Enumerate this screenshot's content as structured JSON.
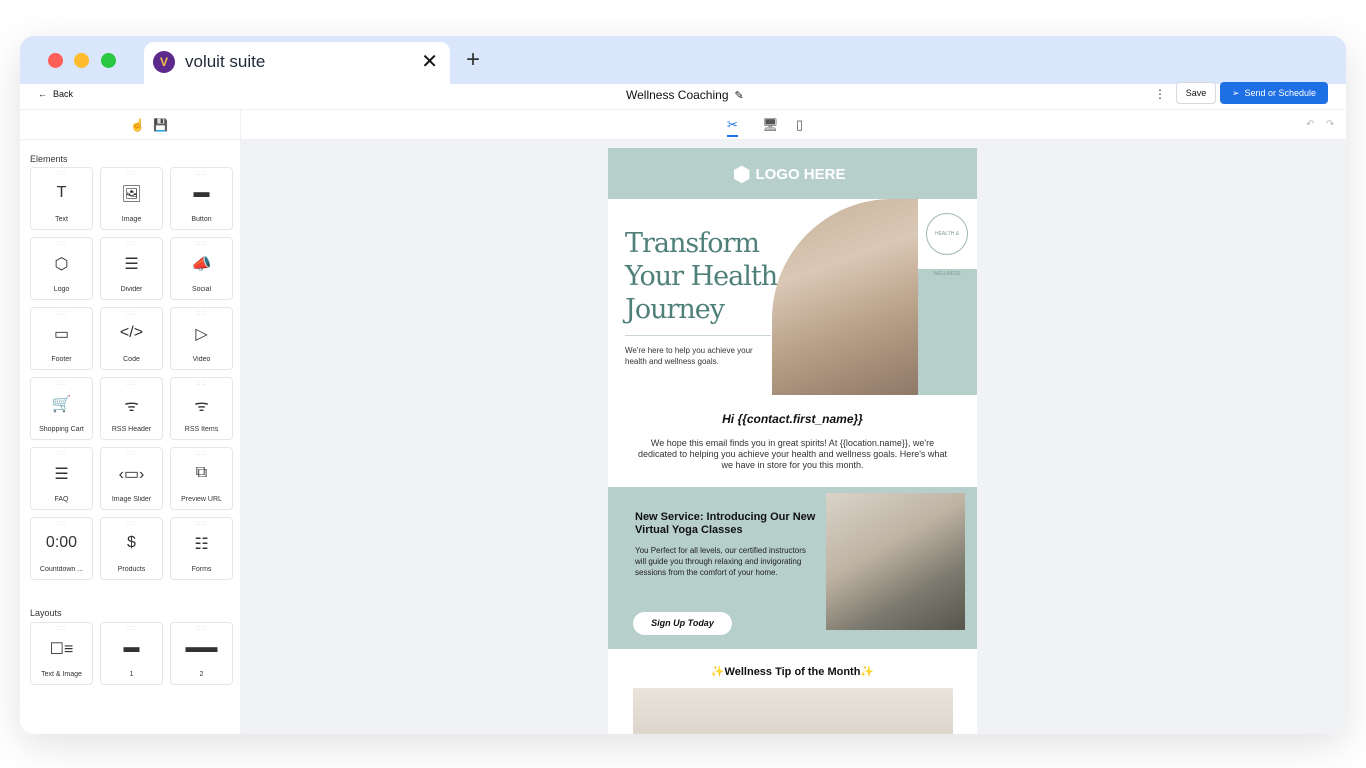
{
  "browser": {
    "tab_title": "voluit suite",
    "tab_close": "✕",
    "new_tab": "+"
  },
  "topbar": {
    "back_label": "Back",
    "document_title": "Wellness Coaching",
    "save_label": "Save",
    "send_label": "Send or Schedule"
  },
  "sidebar": {
    "elements_title": "Elements",
    "elements": [
      {
        "label": "Text",
        "icon": "T"
      },
      {
        "label": "Image",
        "icon": "🖼"
      },
      {
        "label": "Button",
        "icon": "▬"
      },
      {
        "label": "Logo",
        "icon": "⬡"
      },
      {
        "label": "Divider",
        "icon": "☰"
      },
      {
        "label": "Social",
        "icon": "📣"
      },
      {
        "label": "Footer",
        "icon": "▭"
      },
      {
        "label": "Code",
        "icon": "</>"
      },
      {
        "label": "Video",
        "icon": "▷"
      },
      {
        "label": "Shopping Cart",
        "icon": "🛒"
      },
      {
        "label": "RSS Header",
        "icon": "ᯤ"
      },
      {
        "label": "RSS Items",
        "icon": "ᯤ"
      },
      {
        "label": "FAQ",
        "icon": "☰"
      },
      {
        "label": "Image Slider",
        "icon": "‹▭›"
      },
      {
        "label": "Preview URL",
        "icon": "⧉"
      },
      {
        "label": "Countdown ...",
        "icon": "0:00"
      },
      {
        "label": "Products",
        "icon": "$"
      },
      {
        "label": "Forms",
        "icon": "☷"
      }
    ],
    "layouts_title": "Layouts",
    "layouts": [
      {
        "label": "Text & Image",
        "icon": "☐≡"
      },
      {
        "label": "1",
        "icon": "▬"
      },
      {
        "label": "2",
        "icon": "▬▬"
      }
    ]
  },
  "email": {
    "logo_text": "LOGO HERE",
    "hero_title": "Transform Your Health Journey",
    "hero_subtitle": "We're here to help you achieve your health and wellness goals.",
    "badge_text": "HEALTH & WELLNESS",
    "greeting": "Hi {{contact.first_name}}",
    "intro": "We hope this email finds you in great spirits! At {{location.name}}, we're dedicated to helping you achieve your health and wellness goals. Here's what we have in store for you this month.",
    "promo_title": "New Service: Introducing Our New Virtual Yoga Classes",
    "promo_body": "You Perfect for all levels, our certified instructors will guide you through relaxing and invigorating sessions from the comfort of your home.",
    "promo_button": "Sign Up Today",
    "tip_title": "✨Wellness Tip of the Month✨"
  },
  "colors": {
    "accent": "#1f6fe5",
    "brand_teal": "#b6cfcb",
    "headline": "#4f7f79"
  }
}
